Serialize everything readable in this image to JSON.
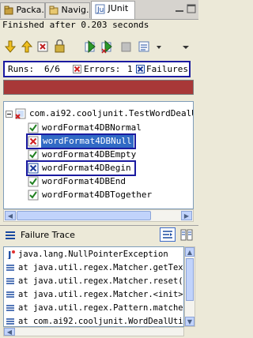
{
  "tabs": [
    {
      "label": "Packa...",
      "icon": "package-icon"
    },
    {
      "label": "Navig...",
      "icon": "navigator-icon"
    },
    {
      "label": "JUnit",
      "icon": "junit-icon",
      "close": "✕"
    }
  ],
  "status": "Finished after 0.203 seconds",
  "toolbar": [
    "next-failure-icon",
    "previous-failure-icon",
    "show-failures-only-icon",
    "scroll-lock-icon",
    "rerun-icon",
    "rerun-failed-icon",
    "stop-icon",
    "history-icon",
    "view-menu-icon"
  ],
  "counts": {
    "runs_label": "Runs:",
    "runs_value": "6/6",
    "errors_label": "Errors:",
    "errors_value": "1",
    "failures_label": "Failures:",
    "failures_value": "1"
  },
  "colors": {
    "progress": "#a83838",
    "selection": "#316ac5",
    "highlight_box": "#1a1aa0"
  },
  "tree": {
    "root": "com.ai92.cooljunit.TestWordDealUti",
    "items": [
      {
        "label": "wordFormat4DBNormal",
        "status": "pass"
      },
      {
        "label": "wordFormat4DBNull",
        "status": "error",
        "selected": true
      },
      {
        "label": "wordFormat4DBEmpty",
        "status": "pass"
      },
      {
        "label": "wordFormat4DBegin",
        "status": "failure"
      },
      {
        "label": "wordFormat4DBEnd",
        "status": "pass"
      },
      {
        "label": "wordFormat4DBTogether",
        "status": "pass"
      }
    ]
  },
  "failure_trace": {
    "title": "Failure Trace",
    "lines": [
      "java.lang.NullPointerException",
      "at java.util.regex.Matcher.getText",
      "at java.util.regex.Matcher.reset(M",
      "at java.util.regex.Matcher.<init>",
      "at java.util.regex.Pattern.matcher",
      "at com.ai92.cooljunit.WordDealUti"
    ]
  }
}
